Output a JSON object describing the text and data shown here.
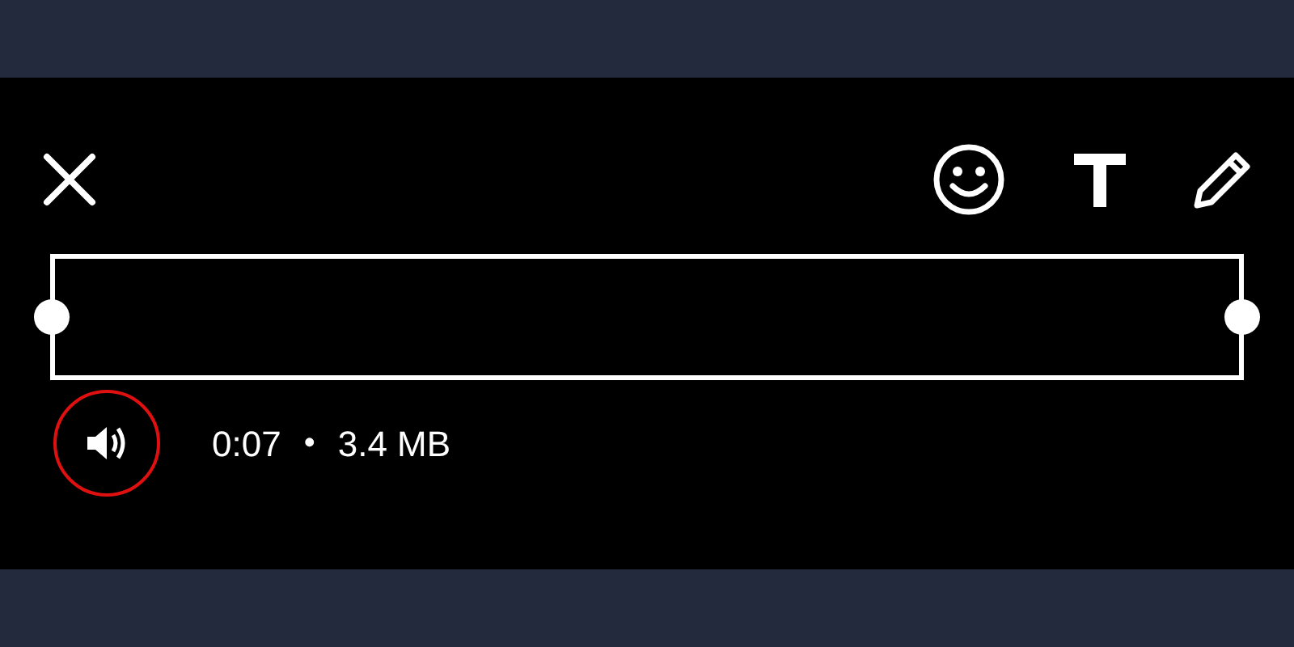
{
  "video_info": {
    "muted": false,
    "duration": "0:07",
    "separator": "•",
    "size": "3.4 MB"
  }
}
